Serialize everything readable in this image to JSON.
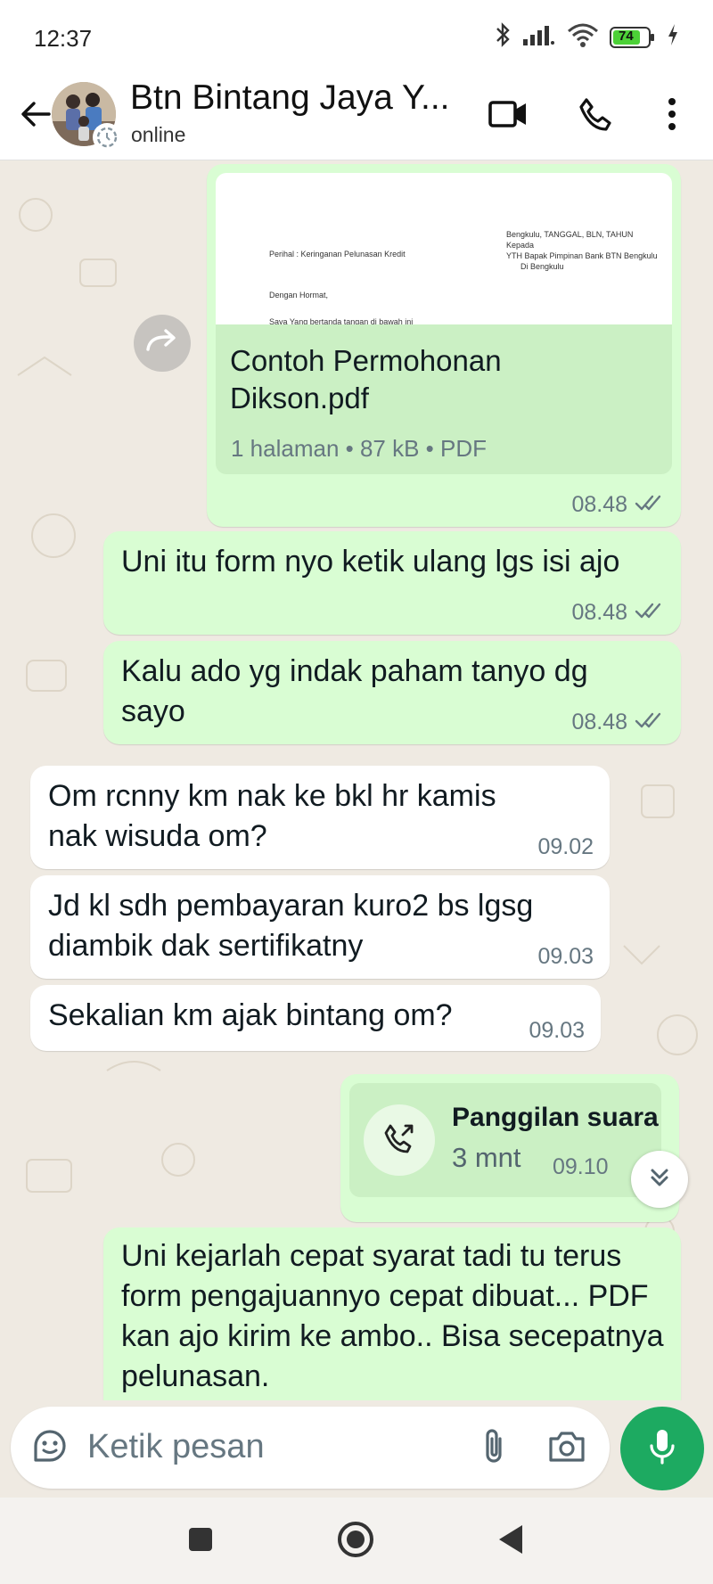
{
  "status_bar": {
    "time": "12:37",
    "battery": "74"
  },
  "header": {
    "contact_name": "Btn Bintang Jaya Y...",
    "contact_status": "online"
  },
  "messages": [
    {
      "type": "document",
      "direction": "outgoing",
      "file_name": "Contoh Permohonan Dikson.pdf",
      "file_meta": "1 halaman • 87 kB • PDF",
      "time": "08.48",
      "preview_lines": [
        "Perihal : Keringanan Pelunasan Kredit",
        "Bengkulu,  TANGGAL, BLN, TAHUN",
        "Kepada",
        "YTH Bapak Pimpinan Bank BTN Bengkulu",
        "Di Bengkulu",
        "Dengan Hormat,",
        "Saya Yang bertanda tangan di bawah ini"
      ]
    },
    {
      "type": "text",
      "direction": "outgoing",
      "text": "Uni itu form nyo ketik ulang lgs isi ajo",
      "time": "08.48"
    },
    {
      "type": "text",
      "direction": "outgoing",
      "text": "Kalu ado yg indak paham tanyo dg sayo",
      "time": "08.48"
    },
    {
      "type": "text",
      "direction": "incoming",
      "text": "Om rcnny km nak ke bkl hr kamis nak wisuda om?",
      "time": "09.02"
    },
    {
      "type": "text",
      "direction": "incoming",
      "text": "Jd kl sdh pembayaran kuro2 bs lgsg diambik dak sertifikatny",
      "time": "09.03"
    },
    {
      "type": "text",
      "direction": "incoming",
      "text": "Sekalian km ajak bintang om?",
      "time": "09.03"
    },
    {
      "type": "call",
      "direction": "outgoing",
      "title": "Panggilan suara",
      "duration": "3 mnt",
      "time": "09.10"
    },
    {
      "type": "text",
      "direction": "outgoing",
      "text": "Uni kejarlah cepat syarat tadi tu terus form pengajuannyo cepat dibuat... PDF kan ajo kirim ke ambo.. Bisa secepatnya pelunasan."
    }
  ],
  "input": {
    "placeholder": "Ketik pesan"
  },
  "icons": {
    "back": "arrow-left-icon",
    "video": "video-call-icon",
    "voice": "phone-icon",
    "menu": "more-vert-icon",
    "forward": "forward-icon",
    "read": "double-check-icon",
    "emoji": "sticker-icon",
    "attach": "paperclip-icon",
    "camera": "camera-icon",
    "mic": "microphone-icon",
    "scroll": "chevron-double-down-icon"
  },
  "colors": {
    "outgoing_bubble": "#d9fdd3",
    "incoming_bubble": "#ffffff",
    "chat_background": "#efeae2",
    "accent_green": "#1daa61",
    "read_ticks": "#667781"
  }
}
